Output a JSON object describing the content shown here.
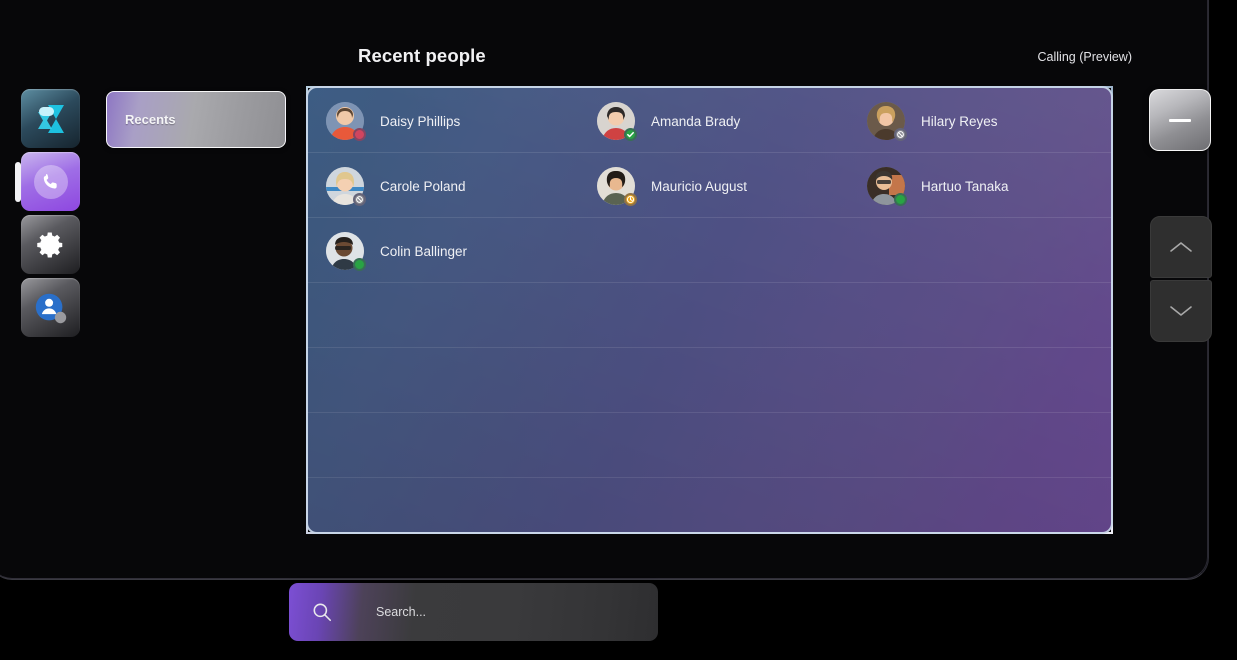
{
  "header": {
    "title": "Recent people",
    "mode_label": "Calling (Preview)"
  },
  "rail": {
    "items": [
      {
        "name": "teams-app",
        "icon": "teams-logo-icon",
        "active": false
      },
      {
        "name": "calls-app",
        "icon": "phone-icon",
        "active": true
      },
      {
        "name": "settings",
        "icon": "gear-icon",
        "active": false
      },
      {
        "name": "account",
        "icon": "account-avatar-icon",
        "active": false
      }
    ]
  },
  "tabs": {
    "recents_label": "Recents"
  },
  "people": [
    {
      "name": "Daisy Phillips",
      "presence": "busy",
      "presence_color": "#d0455f"
    },
    {
      "name": "Amanda Brady",
      "presence": "available",
      "presence_color": "#29a344"
    },
    {
      "name": "Hilary Reyes",
      "presence": "offline",
      "presence_color": "#8a8a92"
    },
    {
      "name": "Carole Poland",
      "presence": "offline",
      "presence_color": "#8a8a92"
    },
    {
      "name": "Mauricio August",
      "presence": "away",
      "presence_color": "#f0ab20"
    },
    {
      "name": "Hartuo Tanaka",
      "presence": "available",
      "presence_color": "#29a344"
    },
    {
      "name": "Colin Ballinger",
      "presence": "available",
      "presence_color": "#29a344"
    }
  ],
  "controls": {
    "minimize_label": "Minimize",
    "scroll_up_label": "Scroll up",
    "scroll_down_label": "Scroll down"
  },
  "search": {
    "placeholder": "Search...",
    "value": ""
  },
  "colors": {
    "accent_purple": "#8e47e0",
    "panel_blue": "#3d5d84",
    "panel_purple": "#65478d"
  }
}
